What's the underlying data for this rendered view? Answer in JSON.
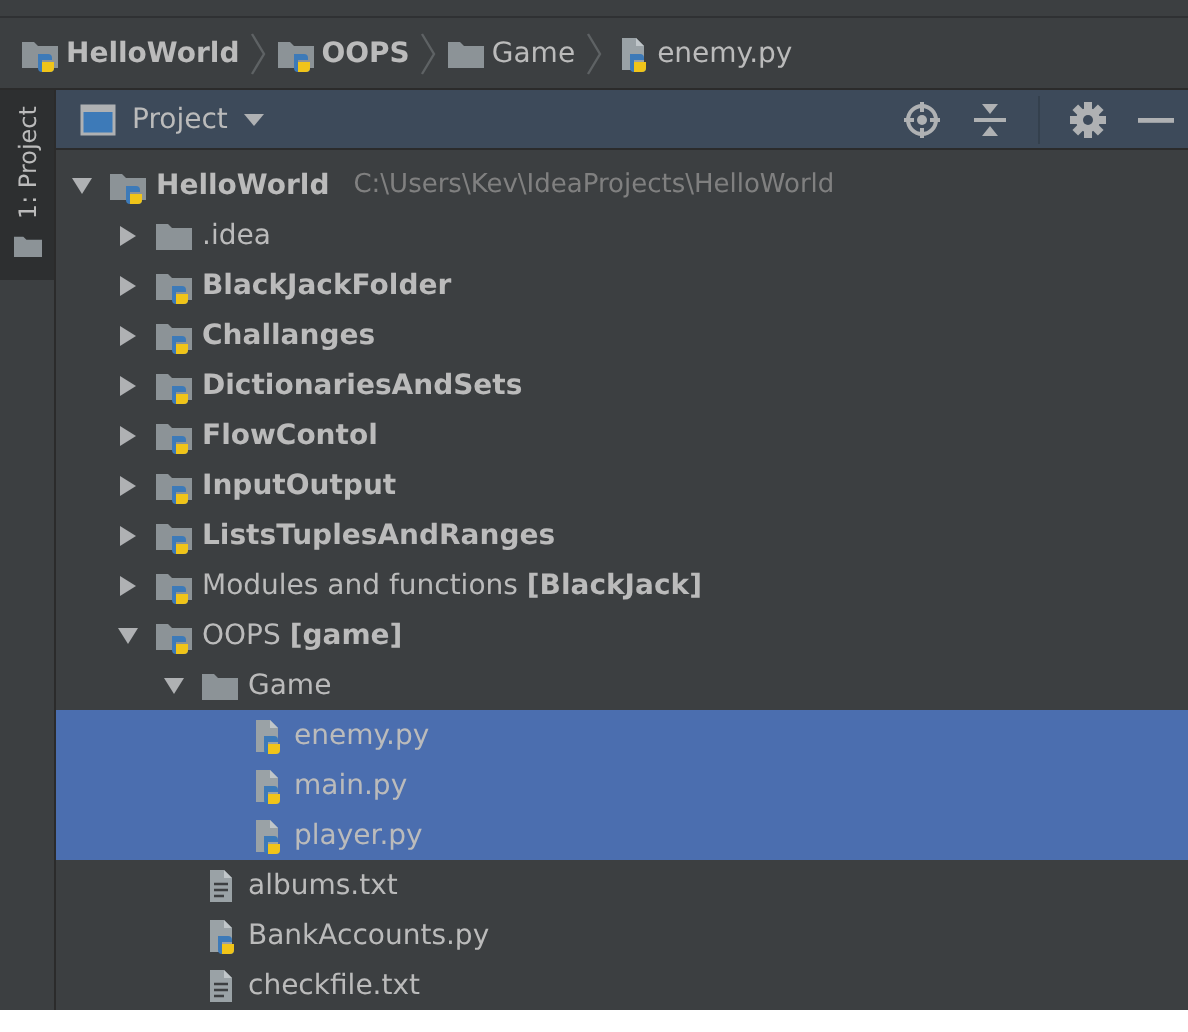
{
  "breadcrumbs": [
    {
      "label": "HelloWorld",
      "kind": "python-folder",
      "bold": true
    },
    {
      "label": "OOPS",
      "kind": "python-folder",
      "bold": true
    },
    {
      "label": "Game",
      "kind": "folder",
      "bold": false
    },
    {
      "label": "enemy.py",
      "kind": "python-file",
      "bold": false
    }
  ],
  "side_tab": {
    "label": "1: Project",
    "selected": true
  },
  "panel": {
    "title": "Project"
  },
  "tree": [
    {
      "label": "HelloWorld",
      "kind": "python-folder",
      "bold": true,
      "path": "C:\\Users\\Kev\\IdeaProjects\\HelloWorld",
      "expanded": true,
      "selected": false,
      "children": [
        {
          "label": ".idea",
          "kind": "folder",
          "bold": false,
          "expanded": false,
          "selected": false
        },
        {
          "label": "BlackJackFolder",
          "kind": "python-folder",
          "bold": true,
          "expanded": false,
          "selected": false
        },
        {
          "label": "Challanges",
          "kind": "python-folder",
          "bold": true,
          "expanded": false,
          "selected": false
        },
        {
          "label": "DictionariesAndSets",
          "kind": "python-folder",
          "bold": true,
          "expanded": false,
          "selected": false
        },
        {
          "label": "FlowContol",
          "kind": "python-folder",
          "bold": true,
          "expanded": false,
          "selected": false
        },
        {
          "label": "InputOutput",
          "kind": "python-folder",
          "bold": true,
          "expanded": false,
          "selected": false
        },
        {
          "label": "ListsTuplesAndRanges",
          "kind": "python-folder",
          "bold": true,
          "expanded": false,
          "selected": false
        },
        {
          "label": "Modules and functions **[BlackJack]**",
          "kind": "python-folder",
          "bold": false,
          "expanded": false,
          "selected": false
        },
        {
          "label": "OOPS **[game]**",
          "kind": "python-folder",
          "bold": false,
          "expanded": true,
          "selected": false,
          "children": [
            {
              "label": "Game",
              "kind": "folder",
              "bold": false,
              "expanded": true,
              "selected": false,
              "children": [
                {
                  "label": "enemy.py",
                  "kind": "python-file",
                  "bold": false,
                  "selected": true
                },
                {
                  "label": "main.py",
                  "kind": "python-file",
                  "bold": false,
                  "selected": true
                },
                {
                  "label": "player.py",
                  "kind": "python-file",
                  "bold": false,
                  "selected": true
                }
              ]
            },
            {
              "label": "albums.txt",
              "kind": "text-file",
              "bold": false,
              "selected": false
            },
            {
              "label": "BankAccounts.py",
              "kind": "python-file",
              "bold": false,
              "selected": false
            },
            {
              "label": "checkfile.txt",
              "kind": "text-file",
              "bold": false,
              "selected": false
            }
          ]
        }
      ]
    }
  ]
}
